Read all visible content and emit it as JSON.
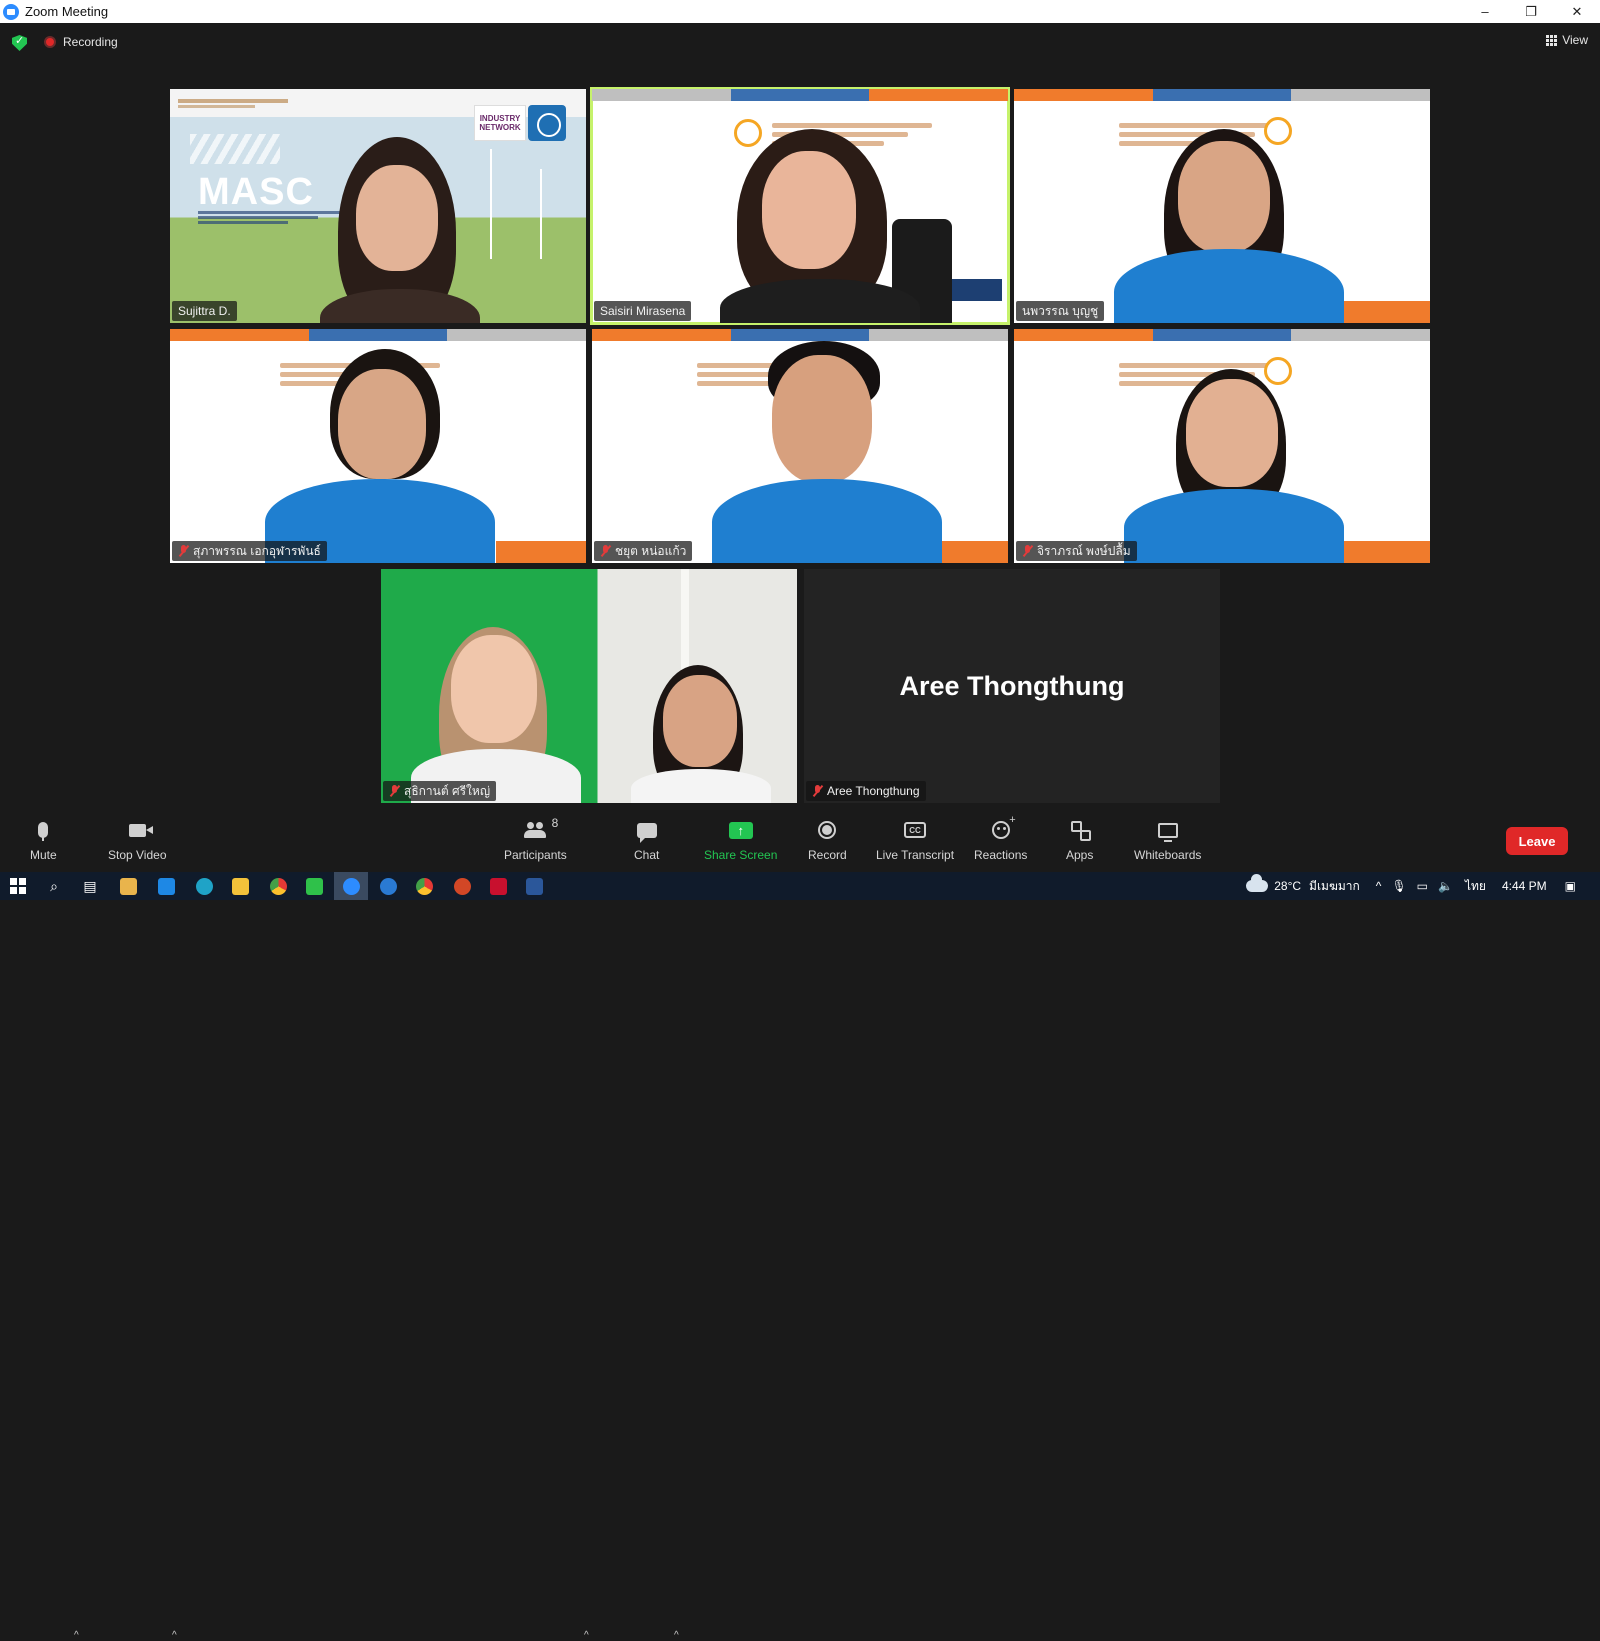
{
  "window": {
    "title": "Zoom Meeting",
    "minimize": "–",
    "maximize": "❐",
    "close": "✕"
  },
  "topbar": {
    "recording_label": "Recording",
    "view_label": "View"
  },
  "participants": [
    {
      "name": "Sujittra D.",
      "muted": false
    },
    {
      "name": "Saisiri Mirasena",
      "muted": false,
      "active_speaker": true
    },
    {
      "name": "นพวรรณ บุญชู",
      "muted": false
    },
    {
      "name": "สุภาพรรณ เอกอุฬารพันธ์",
      "muted": true
    },
    {
      "name": "ชยุต หน่อแก้ว",
      "muted": true
    },
    {
      "name": "จิราภรณ์ พงษ์ปลื้ม",
      "muted": true
    },
    {
      "name": "สุธิกานต์ ศรีใหญ่",
      "muted": true
    },
    {
      "name": "Aree Thongthung",
      "muted": true,
      "video_off": true
    }
  ],
  "tile_text": {
    "masci_logo": "MASC",
    "industry_badge": "INDUSTRY NETWORK"
  },
  "toolbar": {
    "mute": "Mute",
    "stop_video": "Stop Video",
    "participants": "Participants",
    "participants_count": "8",
    "chat": "Chat",
    "share_screen": "Share Screen",
    "record": "Record",
    "live_transcript": "Live Transcript",
    "cc_glyph": "CC",
    "reactions": "Reactions",
    "apps": "Apps",
    "whiteboards": "Whiteboards",
    "leave": "Leave",
    "caret": "^"
  },
  "taskbar": {
    "temperature": "28°C",
    "weather_text": "มีเมฆมาก",
    "language": "ไทย",
    "time": "4:44 PM"
  },
  "colors": {
    "accent_green": "#23c552",
    "active_speaker_border": "#c6f26b",
    "leave_red": "#e02828",
    "zoom_blue": "#2d8cff"
  },
  "icons": [
    "zoom-logo-icon",
    "shield-icon",
    "record-dot-icon",
    "grid-view-icon",
    "mic-icon",
    "camera-icon",
    "participants-icon",
    "chat-icon",
    "share-screen-icon",
    "record-icon",
    "cc-icon",
    "reactions-icon",
    "apps-icon",
    "whiteboard-icon",
    "windows-start-icon",
    "muted-mic-icon"
  ]
}
